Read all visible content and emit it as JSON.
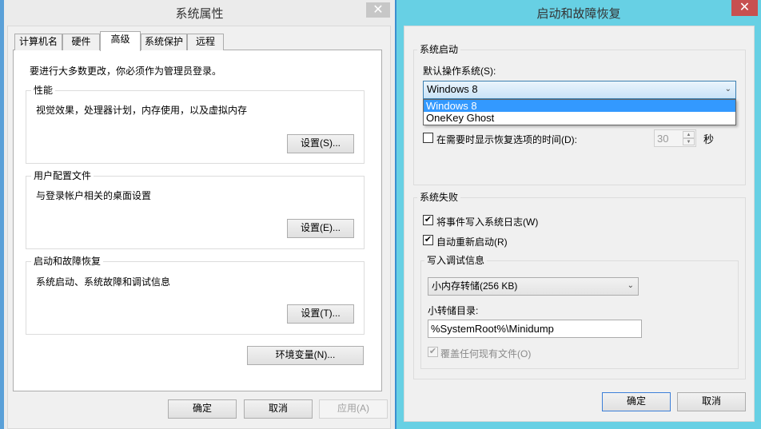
{
  "left_window": {
    "title": "系统属性",
    "close": "✕",
    "tabs": [
      {
        "label": "计算机名"
      },
      {
        "label": "硬件"
      },
      {
        "label": "高级"
      },
      {
        "label": "系统保护"
      },
      {
        "label": "远程"
      }
    ],
    "admin_note": "要进行大多数更改，你必须作为管理员登录。",
    "groups": [
      {
        "title": "性能",
        "description": "视觉效果，处理器计划，内存使用，以及虚拟内存",
        "button": "设置(S)..."
      },
      {
        "title": "用户配置文件",
        "description": "与登录帐户相关的桌面设置",
        "button": "设置(E)..."
      },
      {
        "title": "启动和故障恢复",
        "description": "系统启动、系统故障和调试信息",
        "button": "设置(T)..."
      }
    ],
    "env_button": "环境变量(N)...",
    "ok": "确定",
    "cancel": "取消",
    "apply": "应用(A)"
  },
  "right_window": {
    "title": "启动和故障恢复",
    "close": "✕",
    "startup": {
      "title": "系统启动",
      "default_os_label": "默认操作系统(S):",
      "default_os_value": "Windows 8",
      "options": [
        "Windows 8",
        "OneKey Ghost"
      ],
      "show_time_label": "在需要时显示恢复选项的时间(D):",
      "show_time_checked": false,
      "time_value": "30",
      "seconds": "秒"
    },
    "failure": {
      "title": "系统失败",
      "write_event_label": "将事件写入系统日志(W)",
      "write_event_checked": true,
      "auto_restart_label": "自动重新启动(R)",
      "auto_restart_checked": true,
      "debug": {
        "title": "写入调试信息",
        "dump_type": "小内存转储(256 KB)",
        "dir_label": "小转储目录:",
        "dir_value": "%SystemRoot%\\Minidump",
        "overwrite_label": "覆盖任何现有文件(O)",
        "overwrite_checked": true
      }
    },
    "ok": "确定",
    "cancel": "取消"
  },
  "colors": {
    "accent": "#3399ff",
    "active_frame": "#67d0e4",
    "close_red": "#c75050"
  }
}
